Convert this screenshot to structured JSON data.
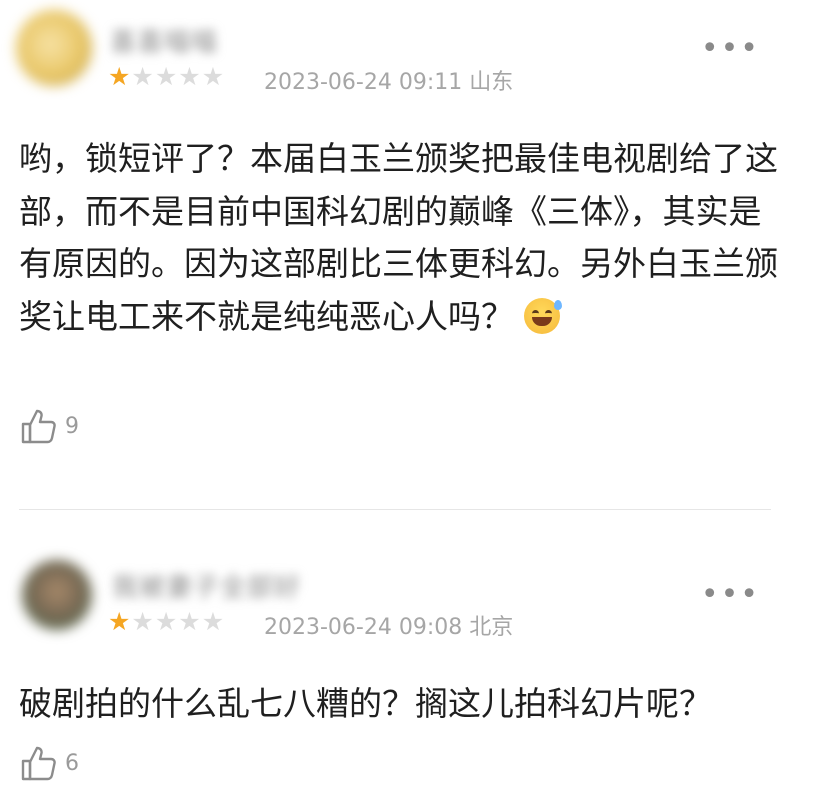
{
  "comments": [
    {
      "username": "喜喜喵喵",
      "rating": 1,
      "max_rating": 5,
      "meta": "2023-06-24 09:11 山东",
      "text": "哟，锁短评了？本届白玉兰颁奖把最佳电视剧给了这部，而不是目前中国科幻剧的巅峰《三体》，其实是有原因的。因为这部剧比三体更科幻。另外白玉兰颁奖让电工来不就是纯纯恶心人吗？",
      "emoji": "grinning-sweat-emoji",
      "likes": "9"
    },
    {
      "username": "我被妻子全部好",
      "rating": 1,
      "max_rating": 5,
      "meta": "2023-06-24 09:08 北京",
      "text": "破剧拍的什么乱七八糟的？搁这儿拍科幻片呢？",
      "likes": "6"
    }
  ],
  "more_icon": "more-dots-icon",
  "like_icon": "thumbs-up-icon",
  "colors": {
    "star_filled": "#f5a623",
    "star_empty": "#dcdcdc",
    "meta_text": "#a6a6a6",
    "body_text": "#1f1f1f",
    "divider": "#e6e6e6"
  }
}
